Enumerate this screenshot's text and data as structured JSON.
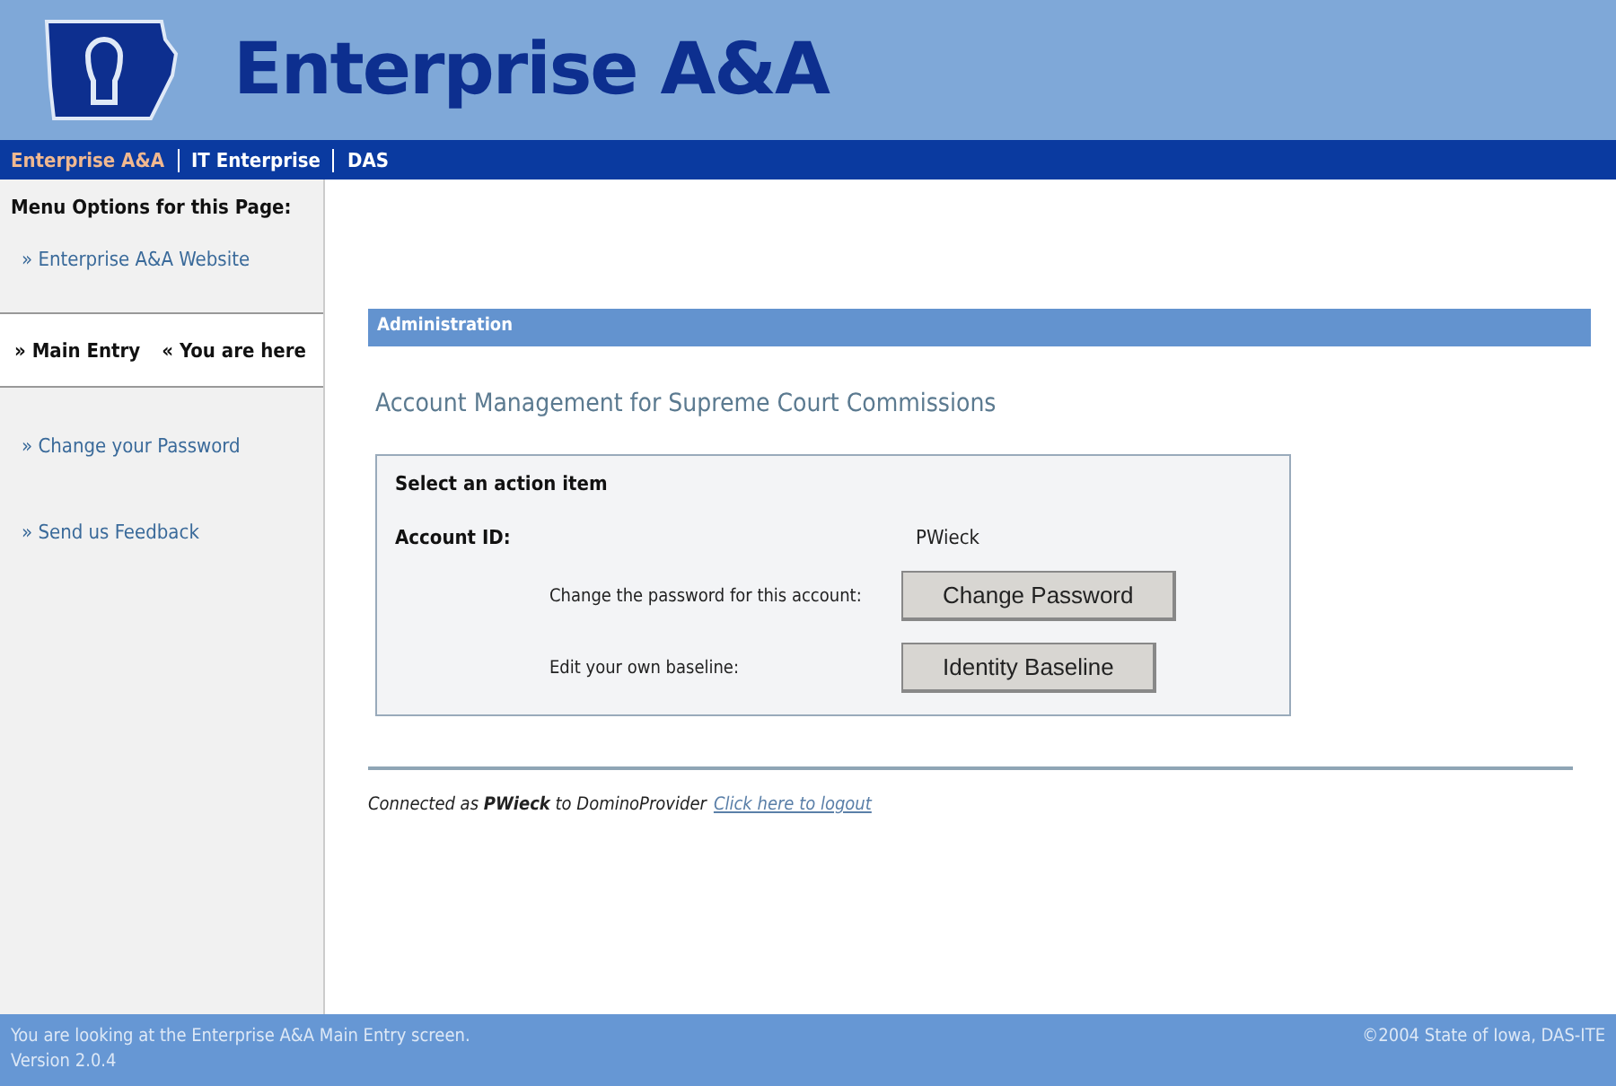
{
  "header": {
    "title": "Enterprise A&A"
  },
  "nav": [
    {
      "label": "Enterprise A&A",
      "selected": true
    },
    {
      "label": "IT Enterprise",
      "selected": false
    },
    {
      "label": "DAS",
      "selected": false
    }
  ],
  "sidebar": {
    "heading": "Menu Options for this Page:",
    "items": [
      {
        "label": "» Enterprise A&A Website",
        "selected": false
      },
      {
        "label": "» Main Entry",
        "note": "« You are here",
        "selected": true
      },
      {
        "label": "» Change your Password",
        "selected": false
      },
      {
        "label": "» Send us Feedback",
        "selected": false
      }
    ]
  },
  "section_bar": "Administration",
  "page_title": "Account Management for Supreme Court Commissions",
  "panel": {
    "heading": "Select an action item",
    "account_label": "Account ID:",
    "account_id": "PWieck",
    "actions": [
      {
        "label": "Change the password for this account:",
        "button": "Change Password"
      },
      {
        "label": "Edit your own baseline:",
        "button": "Identity Baseline"
      }
    ]
  },
  "connection": {
    "text": "Connected as **PWieck** to DominoProvider",
    "link": "Click here to logout"
  },
  "footer": {
    "lines": [
      "You are looking at the Enterprise A&A Main Entry screen.",
      "Version 2.0.4"
    ],
    "copyright": "©2004 State of Iowa, DAS-ITE"
  }
}
